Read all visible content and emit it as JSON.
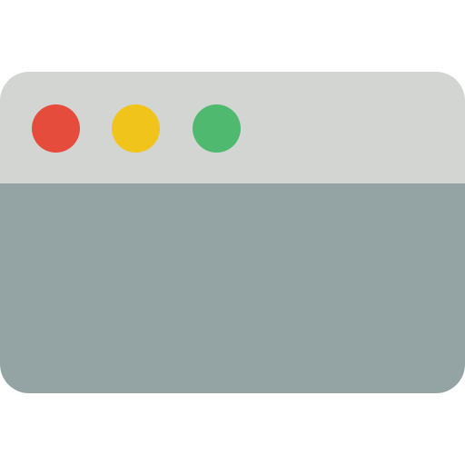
{
  "window": {
    "titlebar_color": "#D3D5D3",
    "content_color": "#94A4A4",
    "controls": [
      {
        "name": "close-button",
        "icon": "red-circle-icon",
        "color": "#E64C3C"
      },
      {
        "name": "minimize-button",
        "icon": "yellow-circle-icon",
        "color": "#F1C41B"
      },
      {
        "name": "maximize-button",
        "icon": "green-circle-icon",
        "color": "#4FBA6F"
      }
    ]
  }
}
